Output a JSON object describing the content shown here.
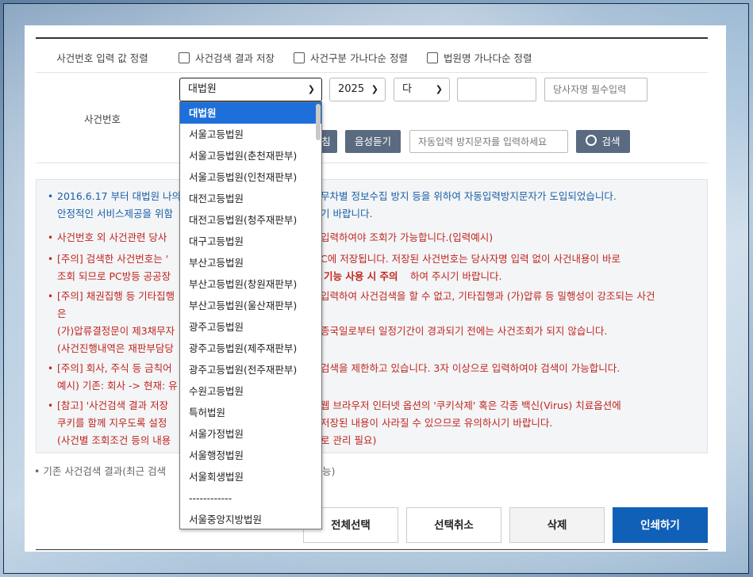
{
  "options_row": {
    "label": "사건번호 입력 값 정렬",
    "checkboxes": [
      "사건검색 결과 저장",
      "사건구분 가나다순 정렬",
      "법원명 가나다순 정렬"
    ]
  },
  "case_row": {
    "label": "사건번호",
    "court_select": "대법원",
    "year_select": "2025",
    "type_select": "다",
    "number_placeholder": "",
    "party_placeholder": "당사자명 필수입력",
    "refresh_btn": "침",
    "audio_btn": "음성듣기",
    "captcha_placeholder": "자동입력 방지문자를 입력하세요",
    "search_btn": "검색"
  },
  "notice": {
    "l1a": "2016.6.17 부터 대법원 나의",
    "l1b": "무차별 정보수집 방지 등을 위하여 자동입력방지문자가 도입되었습니다.",
    "l2a": "안정적인 서비스제공을 위함",
    "l2b": "기 바랍니다.",
    "l3a": "사건번호 외 사건관련 당사",
    "l3b": "입력하여야 조회가 가능합니다.(입력예시)",
    "l4a": "[주의] 검색한 사건번호는 '",
    "l4b": "C에 저장됩니다. 저장된 사건번호는 당사자명 입력 없이 사건내용이 바로",
    "l5a": "조회 되므로 PC방등 공공장",
    "l5b": "기능 사용 시 주의",
    "l5c": "하여 주시기 바랍니다.",
    "l6a": "[주의] 채권집행 등 기타집행",
    "l6b": "입력하여 사건검색을 할 수 없고, 기타집행과 (가)압류 등 밀행성이 강조되는 사건",
    "l7": "은",
    "l8a": "(가)압류결정문이 제3채무자",
    "l8b": "종국일로부터 일정기간이 경과되기 전에는 사건조회가 되지 않습니다.",
    "l9": "(사건진행내역은 재판부담당",
    "l10a": "[주의] 회사, 주식 등 금칙어",
    "l10b": "검색을 제한하고 있습니다. 3자 이상으로 입력하여야 검색이 가능합니다.",
    "l11": "예시) 기존: 회사 -> 현재: 유",
    "l12a": "[참고] '사건검색 결과 저장",
    "l12b": "웹 브라우저 인터넷 옵션의 '쿠키삭제' 혹은 각종 백신(Virus) 치료옵션에",
    "l13a": "쿠키를 함께 지우도록 설정",
    "l13b": "저장된 내용이 사라질 수 있으므로 유의하시기 바랍니다.",
    "l14a": "(사건별 조회조건 등의 내용",
    "l14b": "로 관리 필요)"
  },
  "below": {
    "text_a": "기존 사건검색 결과(최근 검색",
    "text_b": "능)"
  },
  "actions": {
    "select_all": "전체선택",
    "deselect": "선택취소",
    "delete": "삭제",
    "print": "인쇄하기"
  },
  "court_options": [
    "대법원",
    "서울고등법원",
    "서울고등법원(춘천재판부)",
    "서울고등법원(인천재판부)",
    "대전고등법원",
    "대전고등법원(청주재판부)",
    "대구고등법원",
    "부산고등법원",
    "부산고등법원(창원재판부)",
    "부산고등법원(울산재판부)",
    "광주고등법원",
    "광주고등법원(제주재판부)",
    "광주고등법원(전주재판부)",
    "수원고등법원",
    "특허법원",
    "서울가정법원",
    "서울행정법원",
    "서울회생법원",
    "------------",
    "서울중앙지방법원"
  ],
  "colors": {
    "primary": "#1060b8",
    "selected_option": "#1e6fd9",
    "notice_red": "#c0261f",
    "notice_blue": "#1b5fa6"
  }
}
